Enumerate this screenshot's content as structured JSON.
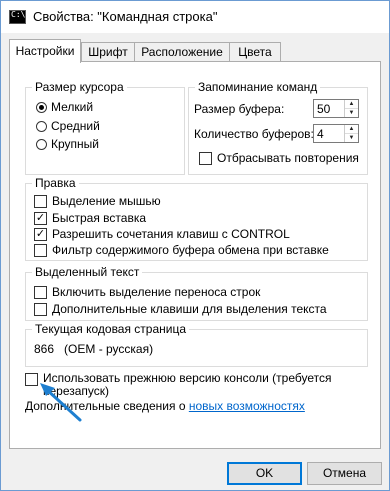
{
  "window": {
    "title": "Свойства: \"Командная строка\"",
    "icon": "console-icon",
    "icon_text": "C:\\"
  },
  "tabs": [
    {
      "label": "Настройки",
      "active": true
    },
    {
      "label": "Шрифт",
      "active": false
    },
    {
      "label": "Расположение",
      "active": false
    },
    {
      "label": "Цвета",
      "active": false
    }
  ],
  "cursor_size": {
    "label": "Размер курсора",
    "options": [
      {
        "label": "Мелкий",
        "selected": true
      },
      {
        "label": "Средний",
        "selected": false
      },
      {
        "label": "Крупный",
        "selected": false
      }
    ]
  },
  "command_history": {
    "label": "Запоминание команд",
    "buffer_size_label": "Размер буфера:",
    "buffer_size_value": "50",
    "buffer_count_label": "Количество буферов:",
    "buffer_count_value": "4",
    "discard_duplicates_label": "Отбрасывать повторения",
    "discard_duplicates_checked": false
  },
  "edit": {
    "label": "Правка",
    "options": [
      {
        "label": "Выделение мышью",
        "checked": false
      },
      {
        "label": "Быстрая вставка",
        "checked": true
      },
      {
        "label": "Разрешить сочетания клавиш с CONTROL",
        "checked": true
      },
      {
        "label": "Фильтр содержимого буфера обмена при вставке",
        "checked": false
      }
    ]
  },
  "selected_text": {
    "label": "Выделенный текст",
    "options": [
      {
        "label": "Включить выделение переноса строк",
        "checked": false
      },
      {
        "label": "Дополнительные клавиши для выделения текста",
        "checked": false
      }
    ]
  },
  "codepage": {
    "label": "Текущая кодовая страница",
    "value": "866   (OEM - русская)"
  },
  "legacy_console": {
    "label_line1": "Использовать прежнюю версию консоли (требуется",
    "label_line2": "перезапуск)",
    "checked": false
  },
  "more_info": {
    "text": "Дополнительные сведения о ",
    "link": "новых возможностях"
  },
  "buttons": {
    "ok": "OK",
    "cancel": "Отмена"
  },
  "colors": {
    "accent": "#0078d7",
    "link": "#0066cc",
    "annotation_arrow": "#1e7fd0"
  }
}
